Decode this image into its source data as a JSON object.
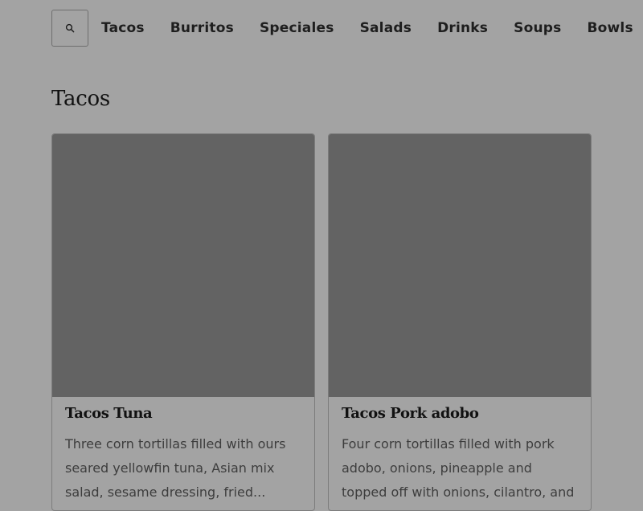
{
  "nav": {
    "search_icon": "search-icon",
    "items": [
      "Tacos",
      "Burritos",
      "Speciales",
      "Salads",
      "Drinks",
      "Soups",
      "Bowls"
    ]
  },
  "section": {
    "title": "Tacos"
  },
  "cards": [
    {
      "title": "Tacos Tuna",
      "description": "Three corn tortillas filled with ours seared yellowfin tuna, Asian mix salad, sesame dressing, fried..."
    },
    {
      "title": "Tacos Pork adobo",
      "description": "Four corn tortillas filled with pork adobo, onions, pineapple and topped off with onions, cilantro, and red..."
    }
  ],
  "colors": {
    "background": "#a3a3a3",
    "image_placeholder": "#636363",
    "border": "#7c7c7c"
  }
}
